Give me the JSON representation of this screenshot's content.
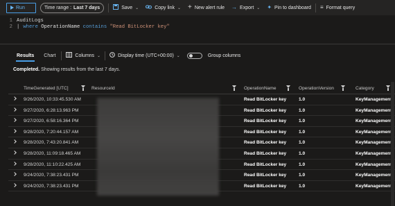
{
  "toolbar": {
    "run_label": "Run",
    "time_range_label": "Time range :",
    "time_range_value": "Last 7 days",
    "save_label": "Save",
    "copy_link_label": "Copy link",
    "new_alert_label": "New alert rule",
    "export_label": "Export",
    "pin_label": "Pin to dashboard",
    "format_label": "Format query"
  },
  "editor": {
    "line1_num": "1",
    "line1_text": "AuditLogs",
    "line2_num": "2",
    "line2_pipe": "|",
    "line2_kw1": "where",
    "line2_ident": "OperationName",
    "line2_kw2": "contains",
    "line2_str": "\"Read BitLocker key\""
  },
  "results_bar": {
    "tab_results": "Results",
    "tab_chart": "Chart",
    "columns_label": "Columns",
    "display_time_label": "Display time (UTC+00:00)",
    "group_columns_label": "Group columns"
  },
  "status": {
    "bold": "Completed.",
    "text": " Showing results from the last 7 days."
  },
  "table": {
    "headers": [
      "TimeGenerated [UTC]",
      "ResourceId",
      "OperationName",
      "OperationVersion",
      "Category"
    ],
    "rows": [
      {
        "time": "9/26/2020, 10:33:45.530 AM",
        "op": "Read BitLocker key",
        "ver": "1.0",
        "cat": "KeyManagement"
      },
      {
        "time": "9/27/2020, 6:28:13.963 PM",
        "op": "Read BitLocker key",
        "ver": "1.0",
        "cat": "KeyManagement"
      },
      {
        "time": "9/27/2020, 6:58:16.364 PM",
        "op": "Read BitLocker key",
        "ver": "1.0",
        "cat": "KeyManagement"
      },
      {
        "time": "9/28/2020, 7:20:44.157 AM",
        "op": "Read BitLocker key",
        "ver": "1.0",
        "cat": "KeyManagement"
      },
      {
        "time": "9/28/2020, 7:43:20.841 AM",
        "op": "Read BitLocker key",
        "ver": "1.0",
        "cat": "KeyManagement"
      },
      {
        "time": "9/28/2020, 11:09:18.465 AM",
        "op": "Read BitLocker key",
        "ver": "1.0",
        "cat": "KeyManagement"
      },
      {
        "time": "9/28/2020, 11:10:22.425 AM",
        "op": "Read BitLocker key",
        "ver": "1.0",
        "cat": "KeyManagement"
      },
      {
        "time": "9/24/2020, 7:38:23.431 PM",
        "op": "Read BitLocker key",
        "ver": "1.0",
        "cat": "KeyManagement"
      },
      {
        "time": "9/24/2020, 7:38:23.431 PM",
        "op": "Read BitLocker key",
        "ver": "1.0",
        "cat": "KeyManagement"
      }
    ]
  },
  "colors": {
    "background": "#1b1a19",
    "accent": "#4aa0e8",
    "keyword": "#569cd6",
    "string": "#ce9178"
  }
}
